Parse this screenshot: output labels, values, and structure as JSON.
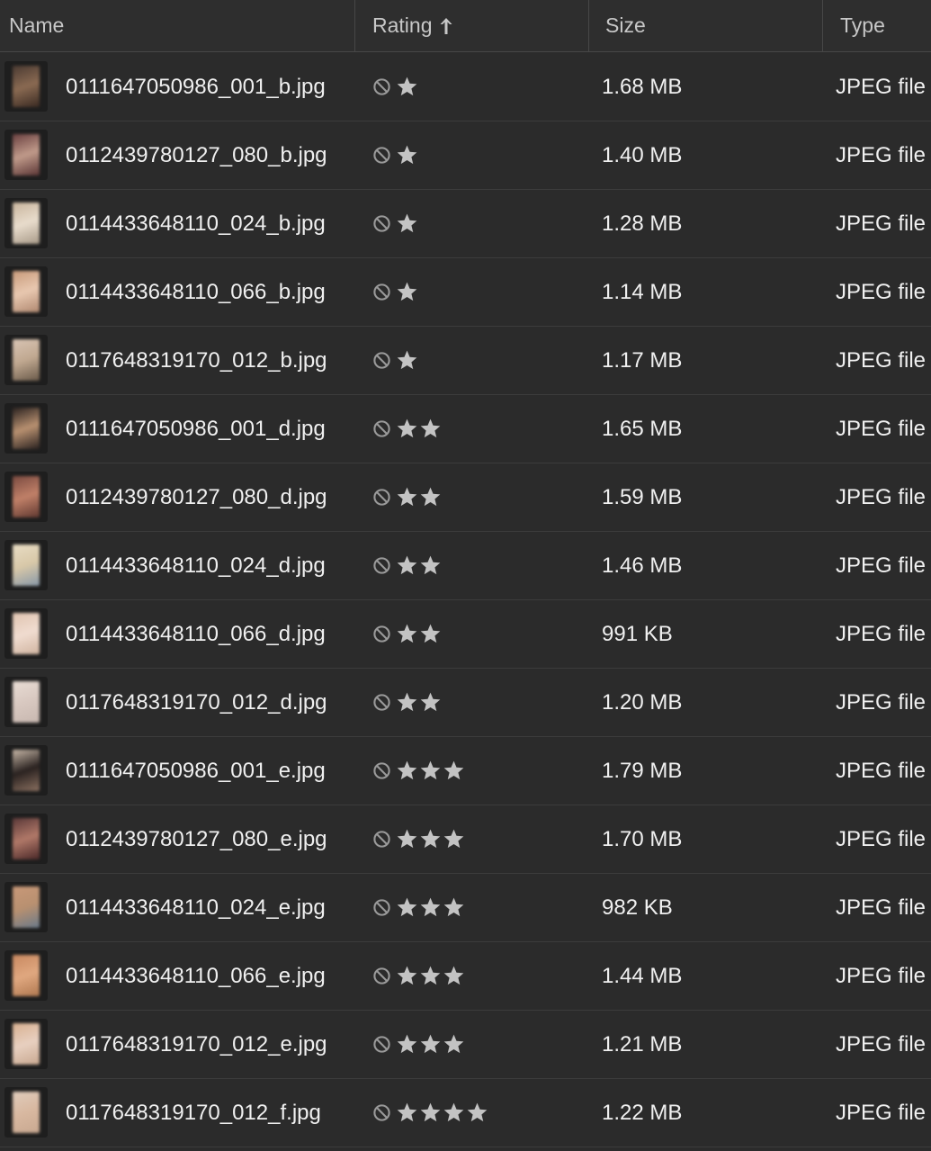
{
  "header": {
    "name": "Name",
    "rating": "Rating",
    "size": "Size",
    "type": "Type",
    "sort_column": "rating",
    "sort_direction": "ascending"
  },
  "colors": {
    "background": "#2b2b2b",
    "header_background": "#2e2e2e",
    "text": "#f0f0f0",
    "header_text": "#c7c7c7",
    "star": "#c3c3c3",
    "no_rating_icon": "#9a9a9a",
    "row_divider": "#3c3c3c"
  },
  "files": [
    {
      "name": "0111647050986_001_b.jpg",
      "rating": 1,
      "size": "1.68 MB",
      "type": "JPEG file",
      "thumb": [
        "#4a3a32",
        "#8a6a52",
        "#3a2a22"
      ]
    },
    {
      "name": "0112439780127_080_b.jpg",
      "rating": 1,
      "size": "1.40 MB",
      "type": "JPEG file",
      "thumb": [
        "#6a4040",
        "#c09a8a",
        "#5a3535"
      ]
    },
    {
      "name": "0114433648110_024_b.jpg",
      "rating": 1,
      "size": "1.28 MB",
      "type": "JPEG file",
      "thumb": [
        "#c8b49c",
        "#e8dccc",
        "#a89a88"
      ]
    },
    {
      "name": "0114433648110_066_b.jpg",
      "rating": 1,
      "size": "1.14 MB",
      "type": "JPEG file",
      "thumb": [
        "#c89a7a",
        "#e8c8b0",
        "#b08870"
      ]
    },
    {
      "name": "0117648319170_012_b.jpg",
      "rating": 1,
      "size": "1.17 MB",
      "type": "JPEG file",
      "thumb": [
        "#d8c4b4",
        "#c0a890",
        "#6a5a4a"
      ]
    },
    {
      "name": "0111647050986_001_d.jpg",
      "rating": 2,
      "size": "1.65 MB",
      "type": "JPEG file",
      "thumb": [
        "#2a2220",
        "#b89070",
        "#2a2220"
      ]
    },
    {
      "name": "0112439780127_080_d.jpg",
      "rating": 2,
      "size": "1.59 MB",
      "type": "JPEG file",
      "thumb": [
        "#7a4a40",
        "#c08068",
        "#603830"
      ]
    },
    {
      "name": "0114433648110_024_d.jpg",
      "rating": 2,
      "size": "1.46 MB",
      "type": "JPEG file",
      "thumb": [
        "#e8dcc4",
        "#d8c8a8",
        "#8898a8"
      ]
    },
    {
      "name": "0114433648110_066_d.jpg",
      "rating": 2,
      "size": "991 KB",
      "type": "JPEG file",
      "thumb": [
        "#e0c4b0",
        "#f0dcd0",
        "#d0b4a0"
      ]
    },
    {
      "name": "0117648319170_012_d.jpg",
      "rating": 2,
      "size": "1.20 MB",
      "type": "JPEG file",
      "thumb": [
        "#e8dcd4",
        "#d8c8c0",
        "#c8b8b0"
      ]
    },
    {
      "name": "0111647050986_001_e.jpg",
      "rating": 3,
      "size": "1.79 MB",
      "type": "JPEG file",
      "thumb": [
        "#c8b8a8",
        "#2a2220",
        "#8a7060"
      ]
    },
    {
      "name": "0112439780127_080_e.jpg",
      "rating": 3,
      "size": "1.70 MB",
      "type": "JPEG file",
      "thumb": [
        "#5a3838",
        "#b07868",
        "#4a2828"
      ]
    },
    {
      "name": "0114433648110_024_e.jpg",
      "rating": 3,
      "size": "982 KB",
      "type": "JPEG file",
      "thumb": [
        "#c89878",
        "#b89070",
        "#6a7a8a"
      ]
    },
    {
      "name": "0114433648110_066_e.jpg",
      "rating": 3,
      "size": "1.44 MB",
      "type": "JPEG file",
      "thumb": [
        "#c88860",
        "#e0a880",
        "#b07850"
      ]
    },
    {
      "name": "0117648319170_012_e.jpg",
      "rating": 3,
      "size": "1.21 MB",
      "type": "JPEG file",
      "thumb": [
        "#d8b090",
        "#e8d0c0",
        "#c8a890"
      ]
    },
    {
      "name": "0117648319170_012_f.jpg",
      "rating": 4,
      "size": "1.22 MB",
      "type": "JPEG file",
      "thumb": [
        "#e0ccbc",
        "#d8b8a0",
        "#c8a890"
      ]
    }
  ]
}
